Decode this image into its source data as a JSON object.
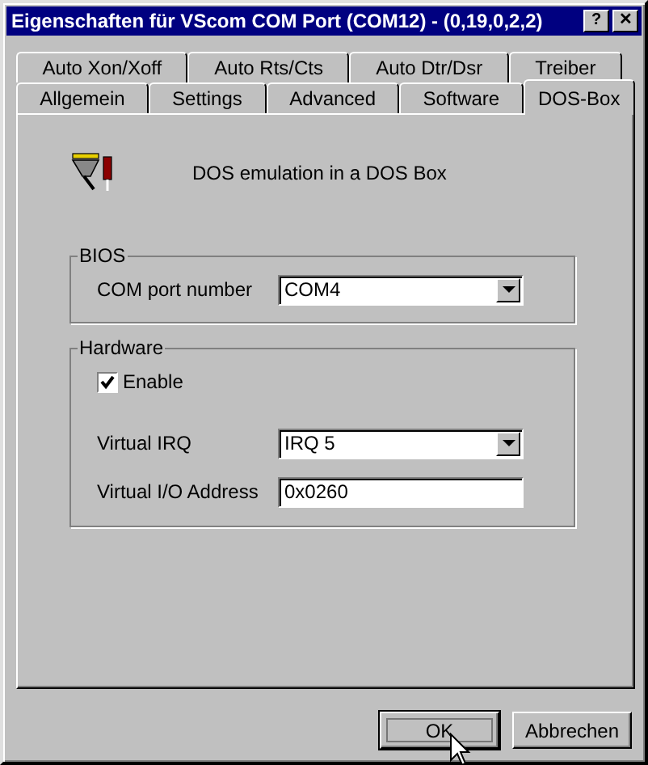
{
  "window": {
    "title": "Eigenschaften für VScom COM Port (COM12) - (0,19,0,2,2)",
    "help_button": "?",
    "close_button": "✕"
  },
  "tab_rows": [
    [
      {
        "label": "Auto Xon/Xoff",
        "selected": false
      },
      {
        "label": "Auto Rts/Cts",
        "selected": false
      },
      {
        "label": "Auto Dtr/Dsr",
        "selected": false
      },
      {
        "label": "Treiber",
        "selected": false
      }
    ],
    [
      {
        "label": "Allgemein",
        "selected": false
      },
      {
        "label": "Settings",
        "selected": false
      },
      {
        "label": "Advanced",
        "selected": false
      },
      {
        "label": "Software",
        "selected": false
      },
      {
        "label": "DOS-Box",
        "selected": true
      }
    ]
  ],
  "description": "DOS emulation in a DOS Box",
  "groups": [
    {
      "title": "BIOS",
      "items": [
        {
          "kind": "combo",
          "label": "COM port number",
          "value": "COM4"
        }
      ]
    },
    {
      "title": "Hardware",
      "items": [
        {
          "kind": "checkbox",
          "label": "Enable",
          "checked": true
        },
        {
          "kind": "combo",
          "label": "Virtual IRQ",
          "value": "IRQ 5"
        },
        {
          "kind": "text",
          "label": "Virtual I/O Address",
          "value": "0x0260"
        }
      ]
    }
  ],
  "buttons": [
    {
      "label": "OK",
      "default": true
    },
    {
      "label": "Abbrechen",
      "default": false
    }
  ]
}
